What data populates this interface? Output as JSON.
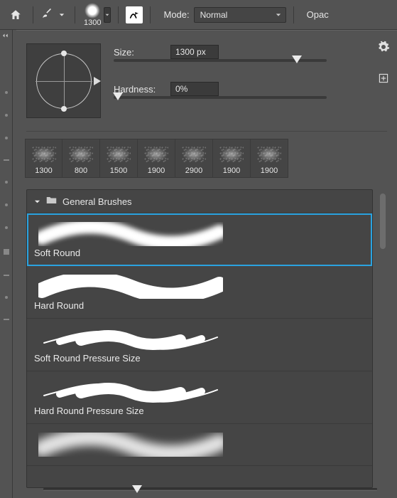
{
  "toolbar": {
    "brush_size_label": "1300",
    "mode_label": "Mode:",
    "mode_value": "Normal",
    "opacity_label": "Opac"
  },
  "panel": {
    "size_label": "Size:",
    "size_value": "1300 px",
    "size_slider_pct": 86,
    "hardness_label": "Hardness:",
    "hardness_value": "0%",
    "hardness_slider_pct": 2
  },
  "recent_brushes": [
    {
      "size": "1300"
    },
    {
      "size": "800"
    },
    {
      "size": "1500"
    },
    {
      "size": "1900"
    },
    {
      "size": "2900"
    },
    {
      "size": "1900"
    },
    {
      "size": "1900"
    }
  ],
  "group_name": "General Brushes",
  "brushes": [
    {
      "name": "Soft Round",
      "style": "soft",
      "selected": true
    },
    {
      "name": "Hard Round",
      "style": "hard",
      "selected": false
    },
    {
      "name": "Soft Round Pressure Size",
      "style": "thin",
      "selected": false
    },
    {
      "name": "Hard Round Pressure Size",
      "style": "thin",
      "selected": false
    },
    {
      "name": "",
      "style": "scatter",
      "selected": false
    }
  ],
  "bottom_zoom_pct": 28
}
